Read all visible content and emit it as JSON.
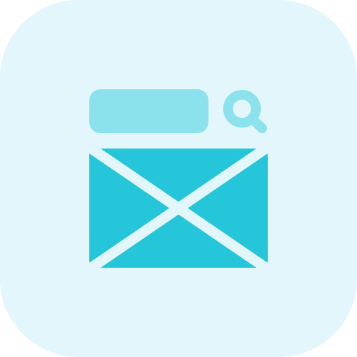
{
  "colors": {
    "tile": "#E2F6FB",
    "accent_light": "#8CE2EC",
    "accent": "#26C6DA",
    "gap": "#E2F6FB"
  },
  "icons": {
    "search": "magnifier-icon",
    "mail": "envelope-icon"
  }
}
